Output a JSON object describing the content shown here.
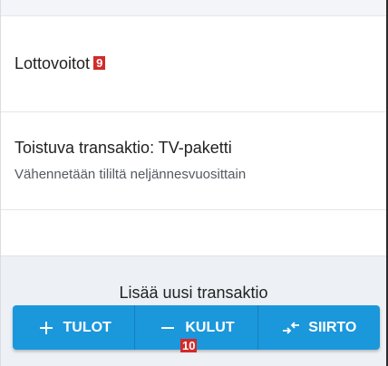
{
  "list": {
    "items": [
      {
        "title": "Lottovoitot",
        "marker": "9"
      },
      {
        "title": "Toistuva transaktio: TV-paketti",
        "subtitle": "Vähennetään tililtä neljännesvuosittain"
      }
    ]
  },
  "bottom": {
    "heading": "Lisää uusi transaktio",
    "buttons": [
      {
        "label": "TULOT",
        "icon": "plus-icon"
      },
      {
        "label": "KULUT",
        "icon": "minus-icon"
      },
      {
        "label": "SIIRTO",
        "icon": "transfer-icon"
      }
    ],
    "marker": "10"
  },
  "colors": {
    "accent": "#1b97dc",
    "marker": "#d42a2a",
    "panel": "#edf1f5"
  }
}
